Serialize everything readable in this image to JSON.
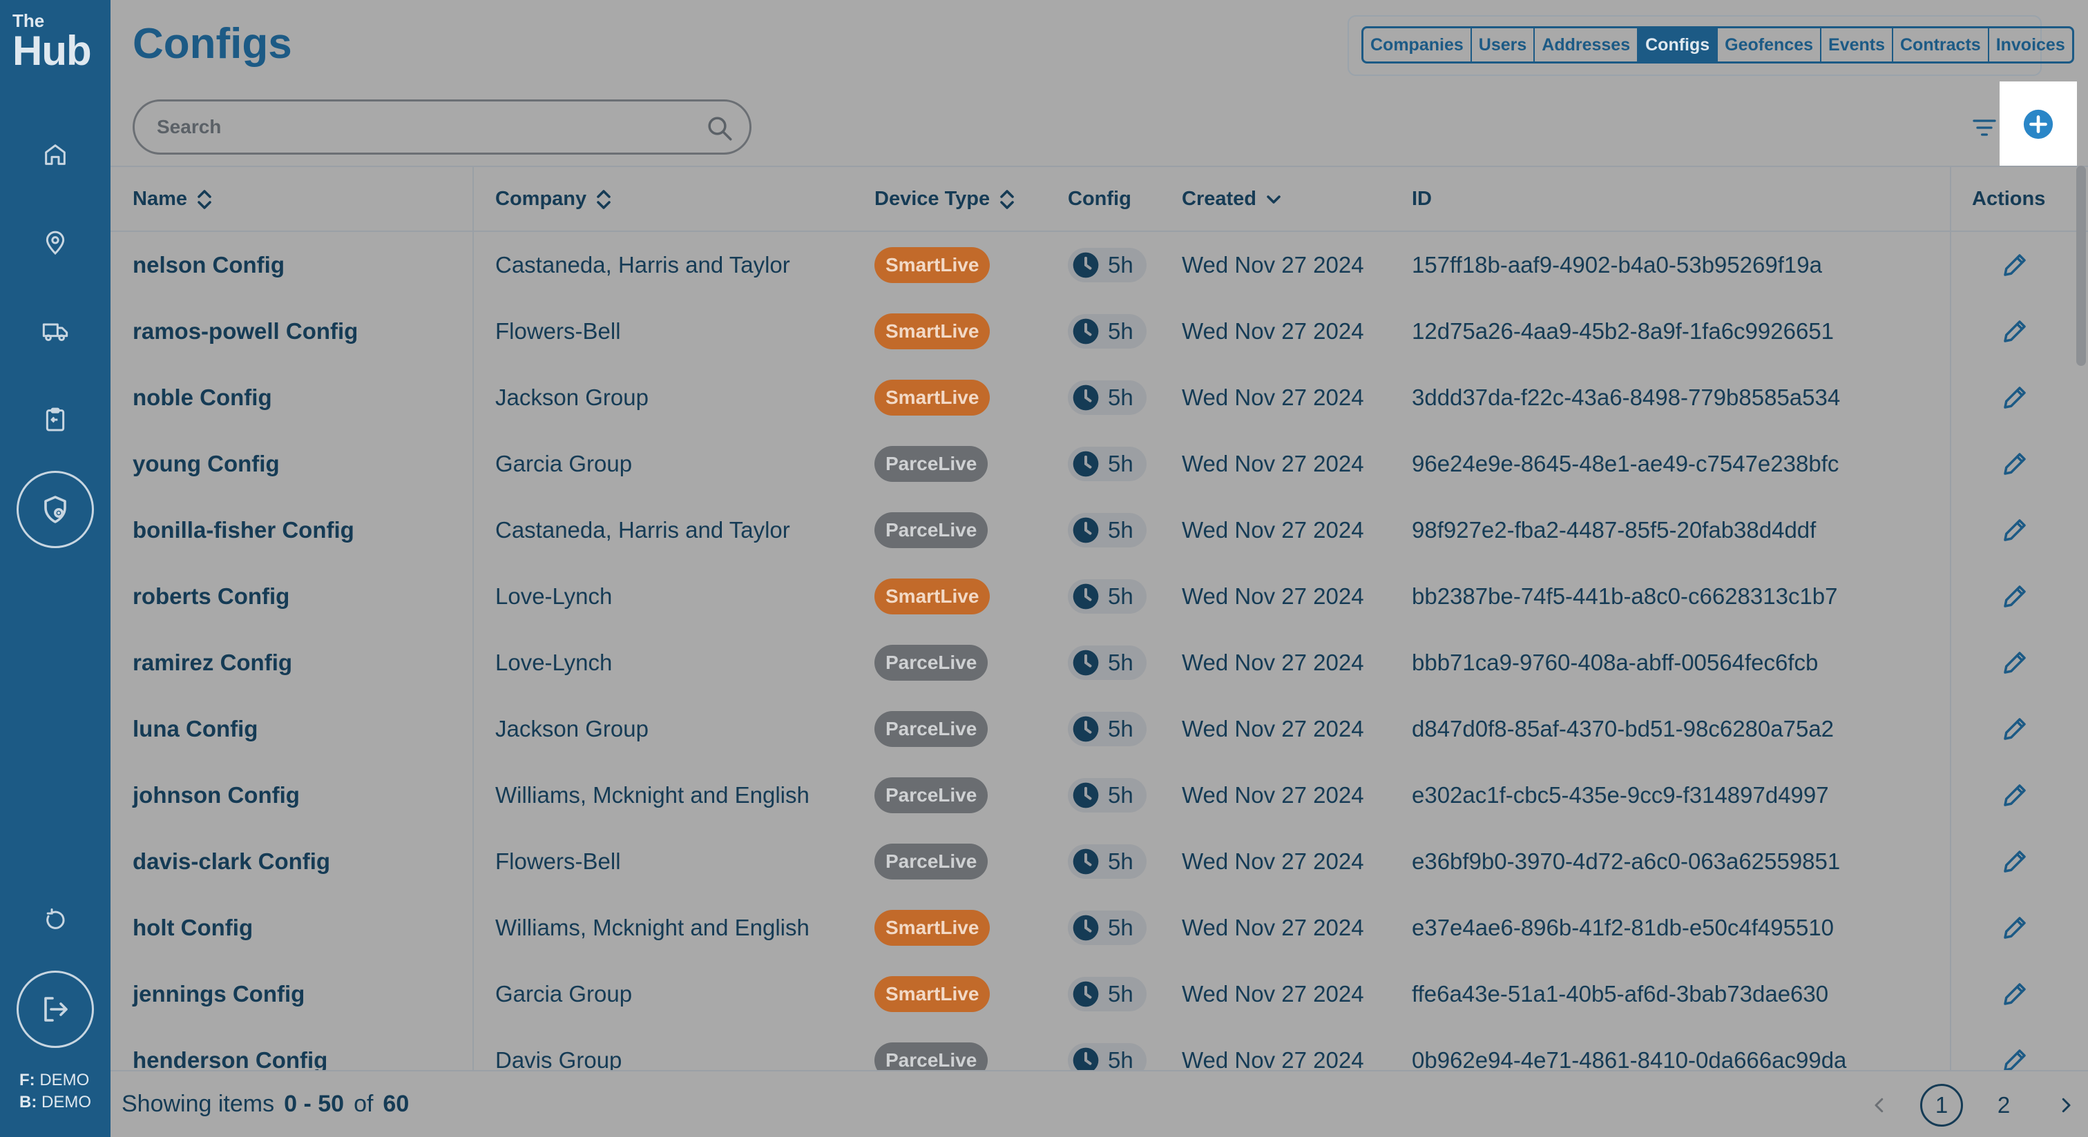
{
  "app": {
    "logo_the": "The",
    "logo_hub": "Hub",
    "footer_f_label": "F:",
    "footer_f_value": "DEMO",
    "footer_b_label": "B:",
    "footer_b_value": "DEMO"
  },
  "sidebar": {
    "items": [
      {
        "icon": "home-icon"
      },
      {
        "icon": "location-pin-icon"
      },
      {
        "icon": "truck-icon"
      },
      {
        "icon": "clipboard-icon"
      },
      {
        "icon": "config-shield-icon",
        "active": true
      }
    ],
    "bottom": [
      {
        "icon": "refresh-icon"
      },
      {
        "icon": "logout-icon"
      }
    ]
  },
  "header": {
    "title": "Configs",
    "tabs": [
      {
        "label": "Companies"
      },
      {
        "label": "Users"
      },
      {
        "label": "Addresses"
      },
      {
        "label": "Configs",
        "active": true
      },
      {
        "label": "Geofences"
      },
      {
        "label": "Events"
      },
      {
        "label": "Contracts"
      },
      {
        "label": "Invoices"
      }
    ]
  },
  "search": {
    "placeholder": "Search",
    "value": ""
  },
  "table": {
    "columns": {
      "name": "Name",
      "company": "Company",
      "device_type": "Device Type",
      "config": "Config",
      "created": "Created",
      "id": "ID",
      "actions": "Actions"
    },
    "rows": [
      {
        "name": "nelson Config",
        "company": "Castaneda, Harris and Taylor",
        "device": "SmartLive",
        "config": "5h",
        "created": "Wed Nov 27 2024",
        "id": "157ff18b-aaf9-4902-b4a0-53b95269f19a"
      },
      {
        "name": "ramos-powell Config",
        "company": "Flowers-Bell",
        "device": "SmartLive",
        "config": "5h",
        "created": "Wed Nov 27 2024",
        "id": "12d75a26-4aa9-45b2-8a9f-1fa6c9926651"
      },
      {
        "name": "noble Config",
        "company": "Jackson Group",
        "device": "SmartLive",
        "config": "5h",
        "created": "Wed Nov 27 2024",
        "id": "3ddd37da-f22c-43a6-8498-779b8585a534"
      },
      {
        "name": "young Config",
        "company": "Garcia Group",
        "device": "ParceLive",
        "config": "5h",
        "created": "Wed Nov 27 2024",
        "id": "96e24e9e-8645-48e1-ae49-c7547e238bfc"
      },
      {
        "name": "bonilla-fisher Config",
        "company": "Castaneda, Harris and Taylor",
        "device": "ParceLive",
        "config": "5h",
        "created": "Wed Nov 27 2024",
        "id": "98f927e2-fba2-4487-85f5-20fab38d4ddf"
      },
      {
        "name": "roberts Config",
        "company": "Love-Lynch",
        "device": "SmartLive",
        "config": "5h",
        "created": "Wed Nov 27 2024",
        "id": "bb2387be-74f5-441b-a8c0-c6628313c1b7"
      },
      {
        "name": "ramirez Config",
        "company": "Love-Lynch",
        "device": "ParceLive",
        "config": "5h",
        "created": "Wed Nov 27 2024",
        "id": "bbb71ca9-9760-408a-abff-00564fec6fcb"
      },
      {
        "name": "luna Config",
        "company": "Jackson Group",
        "device": "ParceLive",
        "config": "5h",
        "created": "Wed Nov 27 2024",
        "id": "d847d0f8-85af-4370-bd51-98c6280a75a2"
      },
      {
        "name": "johnson Config",
        "company": "Williams, Mcknight and English",
        "device": "ParceLive",
        "config": "5h",
        "created": "Wed Nov 27 2024",
        "id": "e302ac1f-cbc5-435e-9cc9-f314897d4997"
      },
      {
        "name": "davis-clark Config",
        "company": "Flowers-Bell",
        "device": "ParceLive",
        "config": "5h",
        "created": "Wed Nov 27 2024",
        "id": "e36bf9b0-3970-4d72-a6c0-063a62559851"
      },
      {
        "name": "holt Config",
        "company": "Williams, Mcknight and English",
        "device": "SmartLive",
        "config": "5h",
        "created": "Wed Nov 27 2024",
        "id": "e37e4ae6-896b-41f2-81db-e50c4f495510"
      },
      {
        "name": "jennings Config",
        "company": "Garcia Group",
        "device": "SmartLive",
        "config": "5h",
        "created": "Wed Nov 27 2024",
        "id": "ffe6a43e-51a1-40b5-af6d-3bab73dae630"
      },
      {
        "name": "henderson Config",
        "company": "Davis Group",
        "device": "ParceLive",
        "config": "5h",
        "created": "Wed Nov 27 2024",
        "id": "0b962e94-4e71-4861-8410-0da666ac99da"
      }
    ]
  },
  "footer": {
    "showing_label": "Showing items",
    "range": "0 - 50",
    "of_label": "of",
    "total": "60",
    "pages": [
      "1",
      "2"
    ],
    "current_page": "1"
  },
  "colors": {
    "brand": "#1c5a85",
    "smartlive": "#c26a2a",
    "parcelive": "#6a6d71",
    "overlay": "#a9a9a9"
  }
}
